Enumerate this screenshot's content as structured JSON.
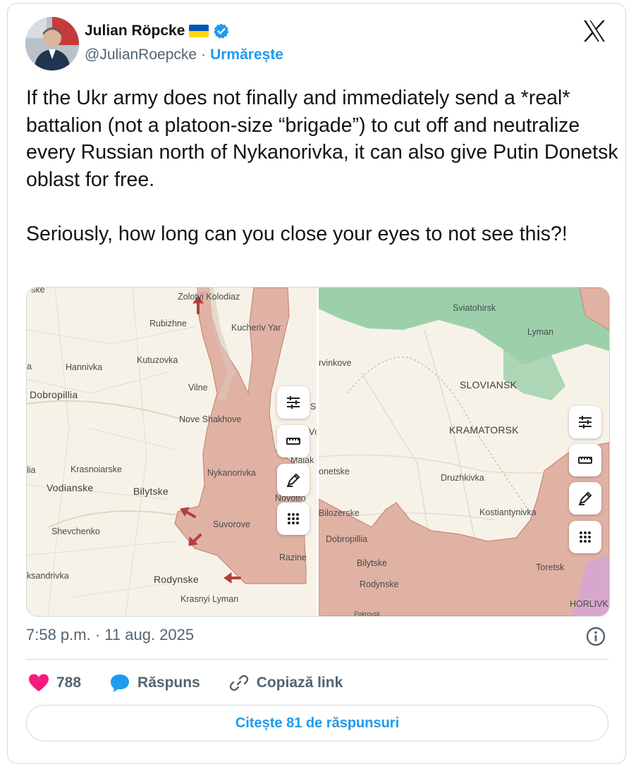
{
  "author": {
    "name": "Julian Röpcke",
    "handle": "@JulianRoepcke",
    "separator": "·",
    "follow_label": "Urmărește"
  },
  "tweet": {
    "text": "If the Ukr army does not finally and immediately send a *real* battalion (not a platoon-size “brigade”) to cut off and neutralize every Russian north of Nykanorivka, it can also give Putin Donetsk oblast for free.\n\nSeriously, how long can you close your eyes to not see this?!"
  },
  "media": {
    "left_map_labels": [
      "ske",
      "Zolotyi Kolodiaz",
      "Rubizhne",
      "Kucheriv Yar",
      "a",
      "Hannivka",
      "Kutuzovka",
      "Dobropillia",
      "Vilne",
      "Nove Shakhove",
      "lia",
      "Krasnoiarske",
      "Nykanorivka",
      "Vodianske",
      "Bilytske",
      "Suvorove",
      "Shevchenko",
      "Razine",
      "ksandrivka",
      "Rodynske",
      "Krasnyi Lyman",
      "S",
      "Vc",
      "Maiak",
      "Novotro"
    ],
    "right_map_labels": [
      "Sviatohirsk",
      "Lyman",
      "rvinkove",
      "SLOVIANSK",
      "KRAMATORSK",
      "onetske",
      "Druzhkivka",
      "Bilozerske",
      "Kostiantynivka",
      "Dobropillia",
      "Bilytske",
      "Toretsk",
      "Rodynske",
      "HORLIVK",
      "Pokrovsk"
    ],
    "colors": {
      "occupied": "#e0b2a4",
      "occupied_border": "#c98778",
      "forest": "#8ccaa0",
      "land": "#f7f2e8",
      "arrow": "#b3403f"
    },
    "tools": [
      "sliders-icon",
      "ruler-icon",
      "pen-icon",
      "grid-icon"
    ]
  },
  "timestamp": "7:58 p.m. · 11 aug. 2025",
  "actions": {
    "likes": "788",
    "reply_label": "Răspuns",
    "copy_label": "Copiază link"
  },
  "read_replies": "Citește 81 de răspunsuri"
}
